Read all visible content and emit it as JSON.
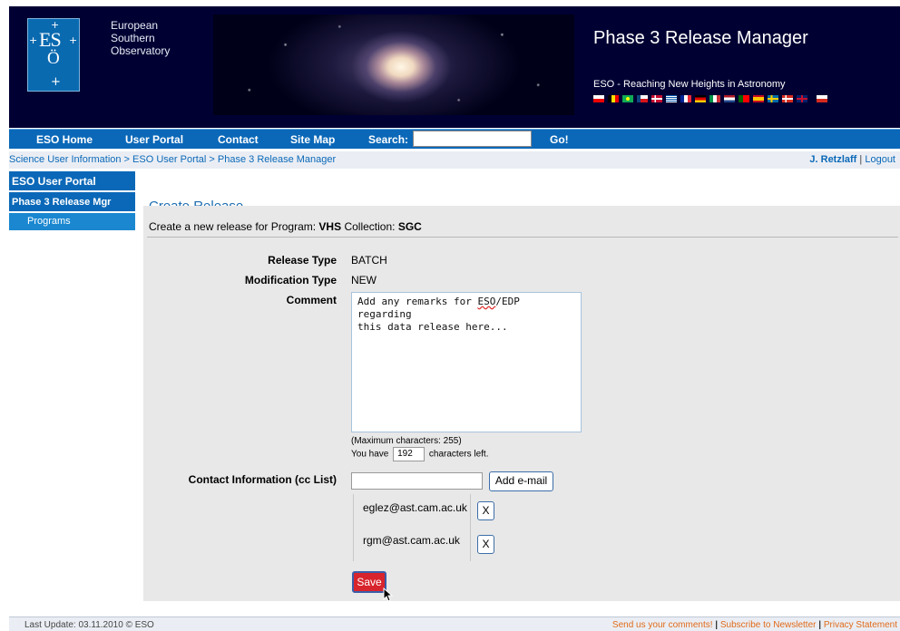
{
  "header": {
    "org_lines": [
      "European",
      "Southern",
      "Observatory"
    ],
    "logo_text": "ES",
    "title": "Phase 3 Release Manager",
    "tagline": "ESO - Reaching New Heights in Astronomy"
  },
  "nav": {
    "items": [
      "ESO Home",
      "User Portal",
      "Contact",
      "Site Map"
    ],
    "search_label": "Search:",
    "go_label": "Go!"
  },
  "breadcrumb": {
    "items": [
      "Science User Information",
      "ESO User Portal",
      "Phase 3 Release Manager"
    ],
    "separator": " > ",
    "user": "J. Retzlaff",
    "logout": "Logout",
    "pipe": " | "
  },
  "sidebar": {
    "portal": "ESO User Portal",
    "release_mgr": "Phase 3 Release Mgr",
    "programs": "Programs"
  },
  "main": {
    "title": "Create Release",
    "subtitle_prefix": "Create a new release for Program: ",
    "program": "VHS",
    "collection_label": " Collection: ",
    "collection": "SGC",
    "release_type_label": "Release Type",
    "release_type": "BATCH",
    "modification_type_label": "Modification Type",
    "modification_type": "NEW",
    "comment_label": "Comment",
    "comment_text": "Add any remarks for ESO/EDP regarding\nthis data release here...",
    "max_chars": "(Maximum characters: 255)",
    "chars_left_prefix": "You have",
    "chars_left": "192",
    "chars_left_suffix": "characters left.",
    "contact_label": "Contact Information (cc List)",
    "add_email": "Add e-mail",
    "emails": [
      "eglez@ast.cam.ac.uk",
      "rgm@ast.cam.ac.uk"
    ],
    "remove_label": "X",
    "save": "Save"
  },
  "footer": {
    "last_update": "Last Update: 03.11.2010 © ESO",
    "links": [
      "Send us your comments!",
      "Subscribe to Newsletter",
      "Privacy Statement"
    ],
    "separator": " | "
  },
  "colors": {
    "header_bg": "#000033",
    "nav_bg": "#0b68b8",
    "accent_link": "#0b68b8",
    "save_button": "#d8242c",
    "footer_link": "#e06a1a"
  }
}
